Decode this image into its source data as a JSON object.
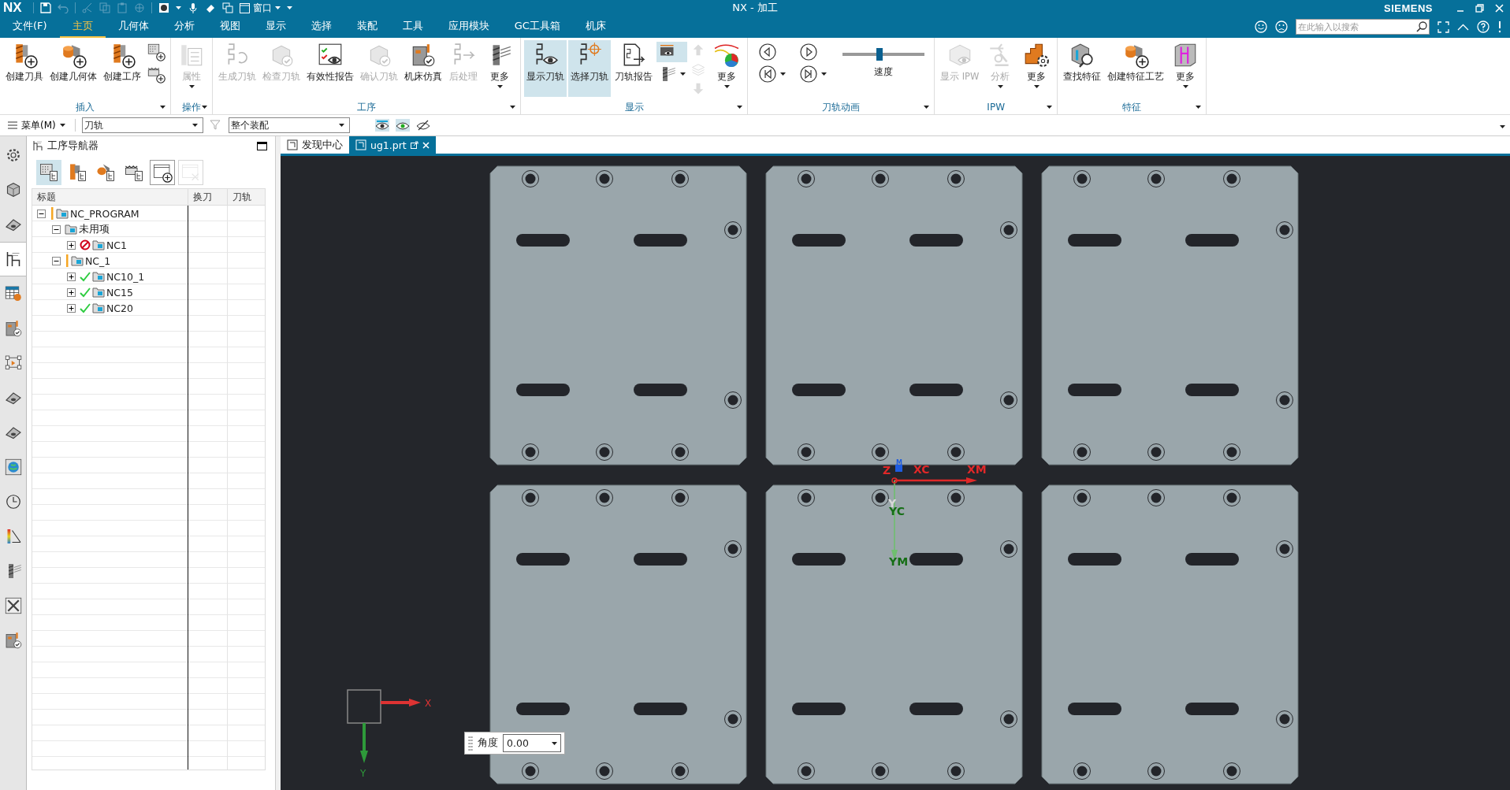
{
  "title_bar": {
    "logo": "NX",
    "window_menu": "窗口",
    "title": "NX - 加工",
    "brand": "SIEMENS"
  },
  "menu_tabs": [
    {
      "label": "文件(F)",
      "selected": false
    },
    {
      "label": "主页",
      "selected": true
    },
    {
      "label": "几何体",
      "selected": false
    },
    {
      "label": "分析",
      "selected": false
    },
    {
      "label": "视图",
      "selected": false
    },
    {
      "label": "显示",
      "selected": false
    },
    {
      "label": "选择",
      "selected": false
    },
    {
      "label": "装配",
      "selected": false
    },
    {
      "label": "工具",
      "selected": false
    },
    {
      "label": "应用模块",
      "selected": false
    },
    {
      "label": "GC工具箱",
      "selected": false
    },
    {
      "label": "机床",
      "selected": false
    }
  ],
  "search": {
    "placeholder": "在此输入以搜索"
  },
  "ribbon": {
    "groups": [
      {
        "label": "插入",
        "items": [
          {
            "kind": "large",
            "label": "创建刀具",
            "disabled": false,
            "active": false,
            "dropdown": false
          },
          {
            "kind": "large",
            "label": "创建几何体",
            "disabled": false,
            "active": false,
            "dropdown": false
          },
          {
            "kind": "large",
            "label": "创建工序",
            "disabled": false,
            "active": false,
            "dropdown": false
          },
          {
            "kind": "stack",
            "icons": [
              {
                "disabled": false,
                "active": false,
                "dropdown": false
              },
              {
                "disabled": false,
                "active": false,
                "dropdown": false
              }
            ]
          }
        ]
      },
      {
        "label": "操作",
        "items": [
          {
            "kind": "large",
            "label": "属性",
            "disabled": true,
            "active": false,
            "dropdown": true
          }
        ]
      },
      {
        "label": "工序",
        "items": [
          {
            "kind": "large",
            "label": "生成刀轨",
            "disabled": true,
            "active": false,
            "dropdown": false
          },
          {
            "kind": "large",
            "label": "检查刀轨",
            "disabled": true,
            "active": false,
            "dropdown": false
          },
          {
            "kind": "large",
            "label": "有效性报告",
            "disabled": false,
            "active": false,
            "dropdown": false
          },
          {
            "kind": "large",
            "label": "确认刀轨",
            "disabled": true,
            "active": false,
            "dropdown": false
          },
          {
            "kind": "large",
            "label": "机床仿真",
            "disabled": false,
            "active": false,
            "dropdown": false
          },
          {
            "kind": "large",
            "label": "后处理",
            "disabled": true,
            "active": false,
            "dropdown": false
          },
          {
            "kind": "large",
            "label": "更多",
            "disabled": false,
            "active": false,
            "dropdown": true
          }
        ]
      },
      {
        "label": "显示",
        "items": [
          {
            "kind": "large",
            "label": "显示刀轨",
            "disabled": false,
            "active": true,
            "dropdown": false
          },
          {
            "kind": "large",
            "label": "选择刀轨",
            "disabled": false,
            "active": true,
            "dropdown": false
          },
          {
            "kind": "large",
            "label": "刀轨报告",
            "disabled": false,
            "active": false,
            "dropdown": false
          },
          {
            "kind": "stack",
            "icons": [
              {
                "disabled": false,
                "active": true,
                "dropdown": false
              },
              {
                "disabled": false,
                "active": false,
                "dropdown": true
              }
            ]
          },
          {
            "kind": "stack",
            "icons": [
              {
                "disabled": true,
                "active": false,
                "dropdown": false
              },
              {
                "disabled": true,
                "active": false,
                "dropdown": false
              },
              {
                "disabled": true,
                "active": false,
                "dropdown": false
              }
            ]
          },
          {
            "kind": "large",
            "label": "更多",
            "disabled": false,
            "active": false,
            "dropdown": true
          }
        ]
      },
      {
        "label": "刀轨动画",
        "items": [
          {
            "kind": "anim",
            "buttons": [
              {
                "dropdown": false
              },
              {
                "dropdown": false
              },
              {
                "dropdown": true
              },
              {
                "dropdown": true
              }
            ]
          },
          {
            "kind": "slider",
            "label": "速度",
            "level": 0.45
          }
        ]
      },
      {
        "label": "IPW",
        "items": [
          {
            "kind": "large",
            "label": "显示 IPW",
            "disabled": true,
            "active": false,
            "dropdown": false
          },
          {
            "kind": "large",
            "label": "分析",
            "disabled": true,
            "active": false,
            "dropdown": true
          },
          {
            "kind": "large",
            "label": "更多",
            "disabled": false,
            "active": false,
            "dropdown": true
          }
        ]
      },
      {
        "label": "特征",
        "items": [
          {
            "kind": "large",
            "label": "查找特征",
            "disabled": false,
            "active": false,
            "dropdown": false
          },
          {
            "kind": "large",
            "label": "创建特征工艺",
            "disabled": false,
            "active": false,
            "dropdown": false
          },
          {
            "kind": "large",
            "label": "更多",
            "disabled": false,
            "active": false,
            "dropdown": true
          }
        ]
      }
    ]
  },
  "toolbar": {
    "menu": "菜单(M)",
    "type_filter": "刀轨",
    "scope": "整个装配"
  },
  "sidebar": {
    "items": [
      {
        "selected": false
      },
      {
        "selected": false
      },
      {
        "selected": false
      },
      {
        "selected": true
      },
      {
        "selected": false
      },
      {
        "selected": false
      },
      {
        "selected": false
      },
      {
        "selected": false
      },
      {
        "selected": false
      },
      {
        "selected": false
      },
      {
        "selected": false
      },
      {
        "selected": false
      },
      {
        "selected": false
      },
      {
        "selected": false
      },
      {
        "selected": false
      }
    ]
  },
  "navigator": {
    "title": "工序导航器",
    "toolbar": [
      {
        "active": true,
        "disabled": false
      },
      {
        "active": false,
        "disabled": false
      },
      {
        "active": false,
        "disabled": false
      },
      {
        "active": false,
        "disabled": false
      },
      {
        "active": false,
        "disabled": false
      },
      {
        "active": false,
        "disabled": true
      }
    ],
    "columns": [
      "标题",
      "换刀",
      "刀轨"
    ],
    "tree": [
      {
        "name": "NC_PROGRAM",
        "kind": "warning",
        "expanded": true,
        "children": [
          {
            "name": "未用项",
            "kind": "plain",
            "expanded": true,
            "children": [
              {
                "name": "NC1",
                "kind": "blocked",
                "expanded": false
              }
            ]
          },
          {
            "name": "NC_1",
            "kind": "warning",
            "expanded": true,
            "children": [
              {
                "name": "NC10_1",
                "kind": "complete",
                "expanded": false
              },
              {
                "name": "NC15",
                "kind": "complete",
                "expanded": false
              },
              {
                "name": "NC20",
                "kind": "complete",
                "expanded": false
              }
            ]
          }
        ]
      }
    ]
  },
  "doc_tabs": [
    {
      "label": "发现中心",
      "selected": false
    },
    {
      "label": "ug1.prt",
      "selected": true
    }
  ],
  "viewport": {
    "wcs_labels": [
      {
        "text": "Z",
        "color": "#e02828"
      },
      {
        "text": "M",
        "color": "#1e5ce0"
      },
      {
        "text": "XC",
        "color": "#e02828"
      },
      {
        "text": "XM",
        "color": "#e02828"
      },
      {
        "text": "Y",
        "color": "#d8d8d8"
      },
      {
        "text": "YC",
        "color": "#156e15"
      },
      {
        "text": "YM",
        "color": "#156e15"
      }
    ],
    "view_triad": {
      "x_label": "X",
      "y_label": "Y"
    },
    "angle": {
      "label": "角度",
      "value": "0.00"
    }
  }
}
